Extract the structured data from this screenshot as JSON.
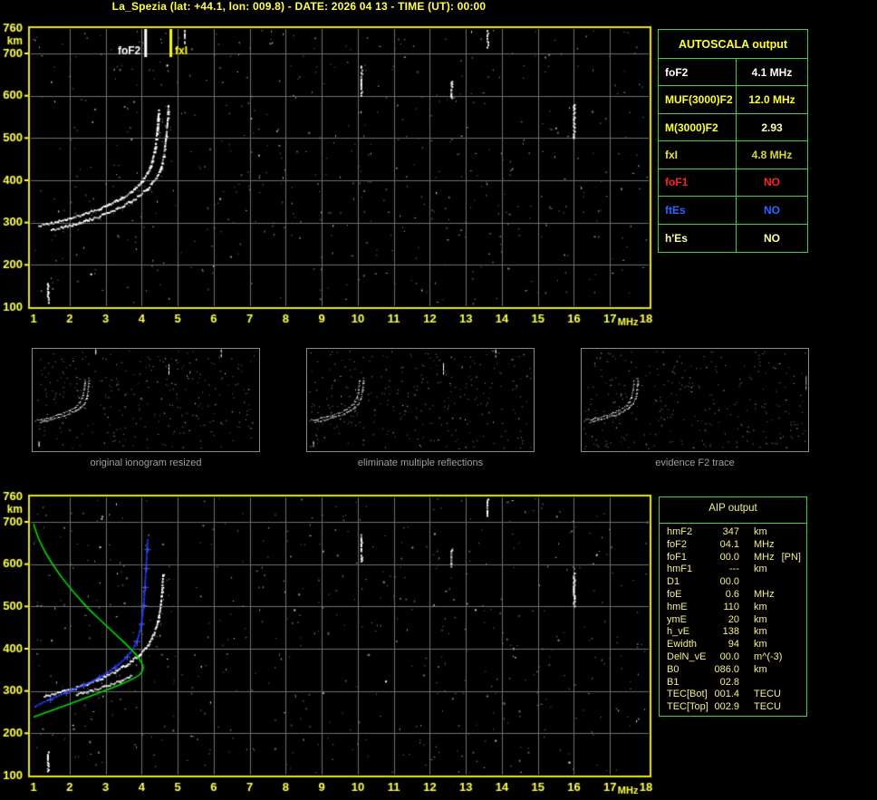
{
  "title": "La_Spezia (lat: +44.1, lon: 009.8) - DATE: 2026 04 13 - TIME (UT): 00:00",
  "colors": {
    "accent_yellow": "#ffff4a",
    "axis_border_yellow": "#e8e800",
    "grid_gray": "#6e6e6e",
    "table_green": "#3fcf3f",
    "caption_gray": "#9f9f9f",
    "aip_text": "#f2ef8e",
    "trace_white": "#ffffff",
    "profile_green": "#00dc00",
    "trace_blue": "#2438ff",
    "marker_fof2": "#ffffff",
    "marker_fxi": "#ffff00"
  },
  "autoscala": {
    "header": "AUTOSCALA output",
    "rows": [
      {
        "label": "foF2",
        "value": "4.1 MHz",
        "label_color": "#ffffff",
        "value_color": "#ffffff"
      },
      {
        "label": "MUF(3000)F2",
        "value": "12.0 MHz",
        "label_color": "#ffff2e",
        "value_color": "#ffff2e"
      },
      {
        "label": "M(3000)F2",
        "value": "2.93",
        "label_color": "#ffff2e",
        "value_color": "#ffffa8"
      },
      {
        "label": "fxI",
        "value": "4.8 MHz",
        "label_color": "#e8e82a",
        "value_color": "#d8d832"
      },
      {
        "label": "foF1",
        "value": "NO",
        "label_color": "#ff2222",
        "value_color": "#ff2222"
      },
      {
        "label": "ftEs",
        "value": "NO",
        "label_color": "#2a66ff",
        "value_color": "#2a66ff"
      },
      {
        "label": "h'Es",
        "value": "NO",
        "label_color": "#ffffa8",
        "value_color": "#ffffa8"
      }
    ]
  },
  "aip": {
    "header": "AIP output",
    "rows": [
      {
        "name": "hmF2",
        "value": "347",
        "unit": "km",
        "extra": ""
      },
      {
        "name": "foF2",
        "value": "04.1",
        "unit": "MHz",
        "extra": ""
      },
      {
        "name": "foF1",
        "value": "00.0",
        "unit": "MHz",
        "extra": "[PN]"
      },
      {
        "name": "hmF1",
        "value": "---",
        "unit": "km",
        "extra": ""
      },
      {
        "name": "D1",
        "value": "00.0",
        "unit": "",
        "extra": ""
      },
      {
        "name": "foE",
        "value": "0.6",
        "unit": "MHz",
        "extra": ""
      },
      {
        "name": "hmE",
        "value": "110",
        "unit": "km",
        "extra": ""
      },
      {
        "name": "ymE",
        "value": "20",
        "unit": "km",
        "extra": ""
      },
      {
        "name": "h_vE",
        "value": "138",
        "unit": "km",
        "extra": ""
      },
      {
        "name": "Ewidth",
        "value": "94",
        "unit": "km",
        "extra": ""
      },
      {
        "name": "DelN_vE",
        "value": "00.0",
        "unit": "m^(-3)",
        "extra": ""
      },
      {
        "name": "B0",
        "value": "086.0",
        "unit": "km",
        "extra": ""
      },
      {
        "name": "B1",
        "value": "02.8",
        "unit": "",
        "extra": ""
      },
      {
        "name": "TEC[Bot]",
        "value": "001.4",
        "unit": "TECU",
        "extra": ""
      },
      {
        "name": "TEC[Top]",
        "value": "002.9",
        "unit": "TECU",
        "extra": ""
      }
    ]
  },
  "thumbnails": {
    "items": [
      {
        "caption": "original ionogram resized",
        "seed": 101,
        "streak_color": "#ffffff",
        "streaks": [
          [
            1.4,
            112,
            158
          ],
          [
            5.2,
            726,
            758
          ],
          [
            10.1,
            602,
            672
          ],
          [
            13.6,
            716,
            756
          ]
        ]
      },
      {
        "caption": "eliminate multiple reflections",
        "seed": 202,
        "streak_color": "#ffffff",
        "streaks": [
          [
            1.4,
            112,
            158
          ],
          [
            10.1,
            602,
            672
          ],
          [
            13.6,
            716,
            756
          ]
        ]
      },
      {
        "caption": "evidence F2 trace",
        "seed": 303,
        "streak_color": "#9a9a9a",
        "streaks": [
          [
            16.0,
            502,
            582
          ]
        ]
      }
    ]
  },
  "chart_data": [
    {
      "id": "top_ionogram",
      "type": "scatter",
      "title": "autoscaled ionogram",
      "xlabel": "MHz",
      "ylabel": "km",
      "x_range": [
        1,
        18
      ],
      "y_range": [
        100,
        760
      ],
      "x_ticks": [
        1,
        2,
        3,
        4,
        5,
        6,
        7,
        8,
        9,
        10,
        11,
        12,
        13,
        14,
        15,
        16,
        17,
        18
      ],
      "y_ticks": [
        100,
        200,
        300,
        400,
        500,
        600,
        700,
        760
      ],
      "grid": true,
      "noise_seed": 7,
      "noise_count": 560,
      "streaks": [
        [
          1.4,
          112,
          158
        ],
        [
          5.2,
          726,
          758
        ],
        [
          10.1,
          602,
          672
        ],
        [
          12.6,
          596,
          636
        ],
        [
          13.6,
          716,
          756
        ],
        [
          16.0,
          502,
          582
        ]
      ],
      "markers": [
        {
          "label": "foF2",
          "f": 4.1,
          "color": "#ffffff",
          "label_side": "left"
        },
        {
          "label": "fxI",
          "f": 4.8,
          "color": "#ffff00",
          "label_side": "right"
        }
      ],
      "traces": [
        {
          "name": "F2 ordinary trace",
          "style": "echo",
          "color": "#ffffff",
          "width": 3,
          "points": [
            [
              1.15,
              291
            ],
            [
              1.5,
              298
            ],
            [
              1.9,
              306
            ],
            [
              2.3,
              316
            ],
            [
              2.7,
              328
            ],
            [
              3.1,
              342
            ],
            [
              3.45,
              357
            ],
            [
              3.75,
              374
            ],
            [
              4.0,
              394
            ],
            [
              4.18,
              418
            ],
            [
              4.3,
              445
            ],
            [
              4.38,
              475
            ],
            [
              4.43,
              510
            ],
            [
              4.46,
              545
            ],
            [
              4.48,
              565
            ]
          ]
        },
        {
          "name": "F2 extraordinary trace",
          "style": "echo",
          "color": "#ffffff",
          "width": 2,
          "points": [
            [
              1.5,
              282
            ],
            [
              1.9,
              290
            ],
            [
              2.3,
              299
            ],
            [
              2.7,
              310
            ],
            [
              3.1,
              323
            ],
            [
              3.5,
              339
            ],
            [
              3.85,
              357
            ],
            [
              4.15,
              378
            ],
            [
              4.4,
              402
            ],
            [
              4.55,
              430
            ],
            [
              4.63,
              462
            ],
            [
              4.68,
              498
            ],
            [
              4.72,
              535
            ],
            [
              4.75,
              580
            ]
          ]
        }
      ]
    },
    {
      "id": "bottom_ionogram",
      "type": "scatter",
      "title": "adjusted profile and restored trace",
      "xlabel": "MHz",
      "ylabel": "km",
      "x_range": [
        1,
        18
      ],
      "y_range": [
        100,
        760
      ],
      "x_ticks": [
        1,
        2,
        3,
        4,
        5,
        6,
        7,
        8,
        9,
        10,
        11,
        12,
        13,
        14,
        15,
        16,
        17,
        18
      ],
      "y_ticks": [
        100,
        200,
        300,
        400,
        500,
        600,
        700,
        760
      ],
      "grid": true,
      "noise_seed": 13,
      "noise_count": 560,
      "streaks": [
        [
          1.4,
          112,
          158
        ],
        [
          10.1,
          602,
          672
        ],
        [
          12.6,
          596,
          636
        ],
        [
          13.6,
          716,
          756
        ],
        [
          16.0,
          502,
          582
        ]
      ],
      "markers": [],
      "traces": [
        {
          "name": "measured F2 trace",
          "style": "echo",
          "color": "#ffffff",
          "width": 3,
          "points": [
            [
              1.3,
              288
            ],
            [
              1.7,
              296
            ],
            [
              2.1,
              305
            ],
            [
              2.5,
              316
            ],
            [
              2.9,
              330
            ],
            [
              3.3,
              347
            ],
            [
              3.65,
              365
            ],
            [
              3.95,
              386
            ],
            [
              4.2,
              410
            ],
            [
              4.35,
              435
            ],
            [
              4.45,
              462
            ],
            [
              4.52,
              492
            ],
            [
              4.56,
              522
            ],
            [
              4.6,
              575
            ]
          ]
        },
        {
          "name": "secondary echo band",
          "style": "echo",
          "color": "#d8d8d8",
          "width": 2,
          "points": [
            [
              2.2,
              292
            ],
            [
              2.6,
              300
            ],
            [
              3.0,
              310
            ],
            [
              3.4,
              322
            ],
            [
              3.7,
              335
            ]
          ]
        },
        {
          "name": "computed virtual height trace",
          "style": "dotplus",
          "color": "#2438ff",
          "width": 2,
          "points": [
            [
              1.05,
              263
            ],
            [
              1.2,
              270
            ],
            [
              1.4,
              278
            ],
            [
              1.65,
              287
            ],
            [
              1.9,
              296
            ],
            [
              2.15,
              305
            ],
            [
              2.4,
              314
            ],
            [
              2.65,
              324
            ],
            [
              2.9,
              336
            ],
            [
              3.15,
              349
            ],
            [
              3.35,
              362
            ],
            [
              3.55,
              377
            ],
            [
              3.7,
              392
            ],
            [
              3.82,
              408
            ],
            [
              3.9,
              425
            ],
            [
              3.96,
              443
            ],
            [
              4.0,
              462
            ],
            [
              4.03,
              482
            ],
            [
              4.06,
              505
            ],
            [
              4.08,
              530
            ],
            [
              4.1,
              556
            ],
            [
              4.12,
              585
            ],
            [
              4.15,
              630
            ],
            [
              4.17,
              658
            ]
          ]
        },
        {
          "name": "electron density profile (plasma frequency vs height)",
          "style": "line",
          "color": "#00dc00",
          "width": 1.6,
          "points": [
            [
              1.0,
              695
            ],
            [
              1.1,
              668
            ],
            [
              1.25,
              640
            ],
            [
              1.45,
              610
            ],
            [
              1.7,
              578
            ],
            [
              2.0,
              545
            ],
            [
              2.3,
              515
            ],
            [
              2.6,
              488
            ],
            [
              2.95,
              460
            ],
            [
              3.3,
              432
            ],
            [
              3.6,
              408
            ],
            [
              3.85,
              386
            ],
            [
              4.0,
              368
            ],
            [
              4.05,
              357
            ],
            [
              4.02,
              345
            ],
            [
              3.9,
              335
            ],
            [
              3.6,
              322
            ],
            [
              3.2,
              308
            ],
            [
              2.7,
              292
            ],
            [
              2.2,
              275
            ],
            [
              1.7,
              260
            ],
            [
              1.3,
              248
            ],
            [
              1.0,
              238
            ]
          ]
        }
      ]
    }
  ]
}
